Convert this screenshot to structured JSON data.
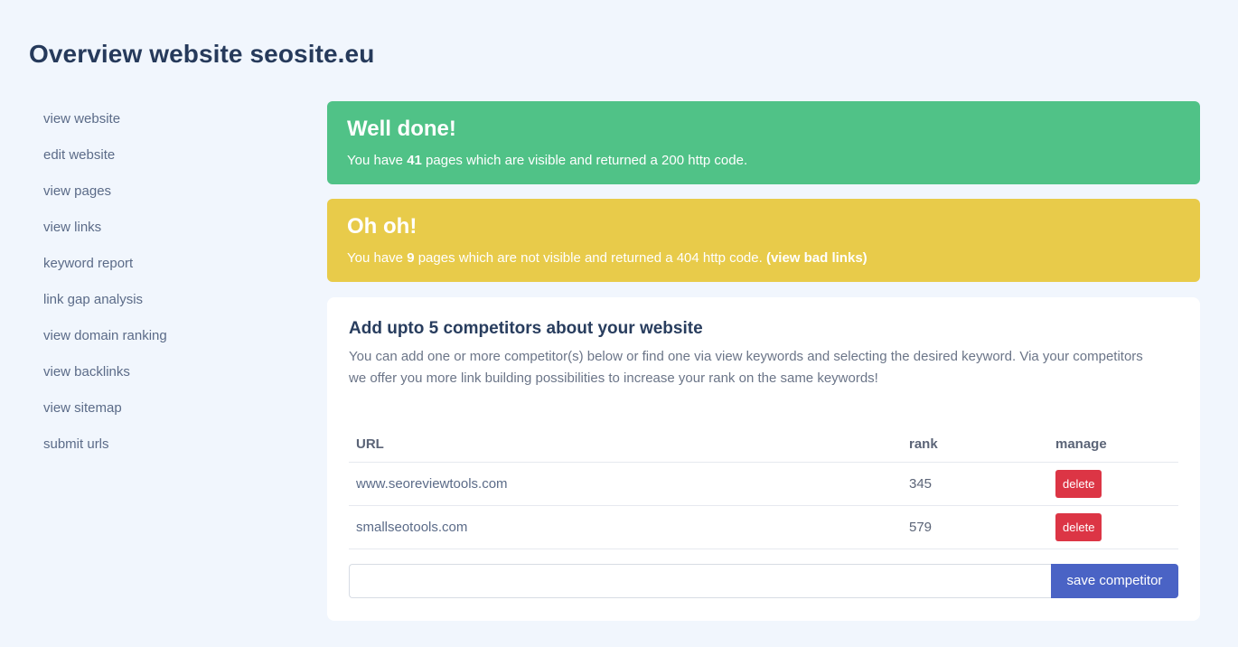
{
  "header": {
    "title": "Overview website seosite.eu"
  },
  "sidebar": {
    "items": [
      {
        "label": "view website"
      },
      {
        "label": "edit website"
      },
      {
        "label": "view pages"
      },
      {
        "label": "view links"
      },
      {
        "label": "keyword report"
      },
      {
        "label": "link gap analysis"
      },
      {
        "label": "view domain ranking"
      },
      {
        "label": "view backlinks"
      },
      {
        "label": "view sitemap"
      },
      {
        "label": "submit urls"
      }
    ]
  },
  "alerts": {
    "success": {
      "heading": "Well done!",
      "prefix": "You have ",
      "count": "41",
      "suffix": " pages which are visible and returned a 200 http code.",
      "color": "#50c287"
    },
    "warning": {
      "heading": "Oh oh!",
      "prefix": "You have ",
      "count": "9",
      "suffix": " pages which are not visible and returned a 404 http code. ",
      "link_open": "(",
      "link_label": "view bad links",
      "link_close": ")",
      "color": "#e8cb4a"
    }
  },
  "competitors": {
    "title": "Add upto 5 competitors about your website",
    "description": "You can add one or more competitor(s) below or find one via view keywords and selecting the desired keyword. Via your competitors we offer you more link building possibilities to increase your rank on the same keywords!",
    "columns": {
      "url": "URL",
      "rank": "rank",
      "manage": "manage"
    },
    "rows": [
      {
        "url": "www.seoreviewtools.com",
        "rank": "345",
        "action": "delete"
      },
      {
        "url": "smallseotools.com",
        "rank": "579",
        "action": "delete"
      }
    ],
    "input": {
      "value": "",
      "placeholder": ""
    },
    "save_label": "save competitor",
    "colors": {
      "delete": "#dc3545",
      "save": "#4a63c5"
    }
  }
}
